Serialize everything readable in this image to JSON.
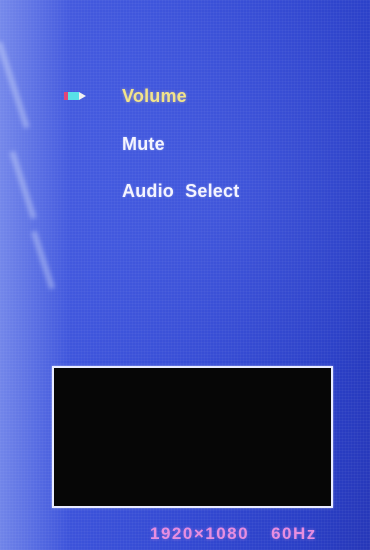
{
  "osd": {
    "menu": {
      "items": [
        {
          "label": "Volume",
          "selected": true
        },
        {
          "label": "Mute",
          "selected": false
        },
        {
          "label": "Audio  Select",
          "selected": false
        }
      ],
      "selector_icon": "pencil-pointer-icon"
    },
    "status": {
      "resolution": "1920×1080",
      "refresh_rate": "60Hz"
    },
    "colors": {
      "background": "#3a50d8",
      "menu_text": "#f4f4ff",
      "selected_text": "#f3e48a",
      "status_text": "#e78ee0",
      "preview_fill": "#060606",
      "preview_border": "#e9ecff"
    }
  }
}
